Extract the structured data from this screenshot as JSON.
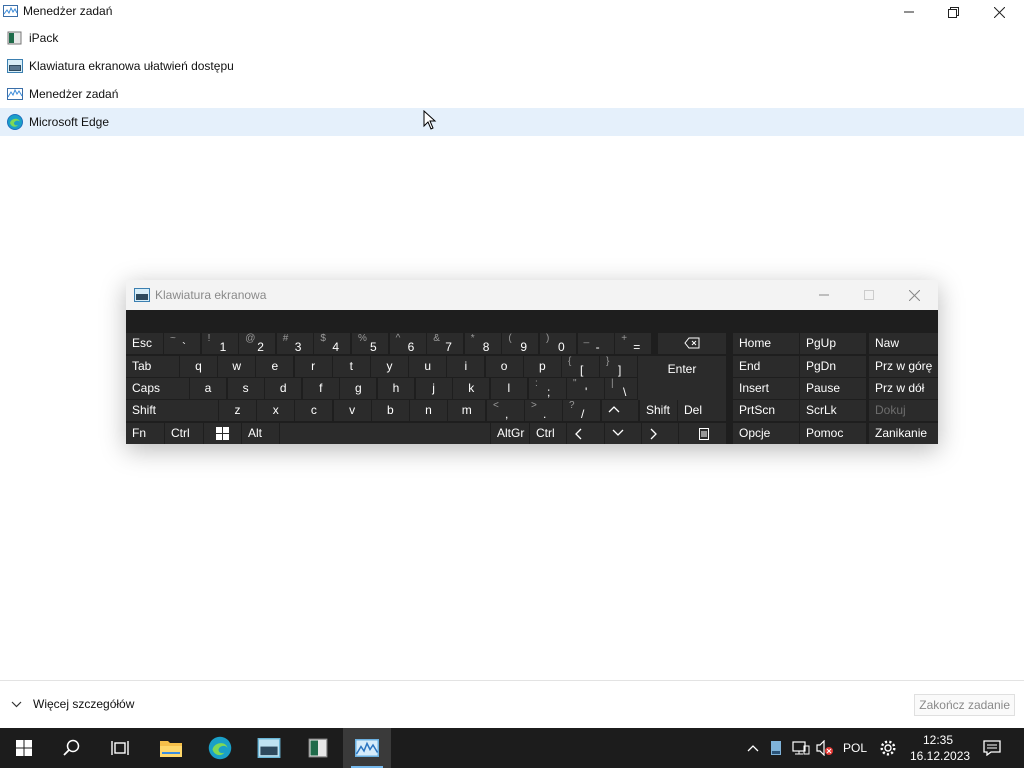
{
  "window": {
    "title": "Menedżer zadań"
  },
  "processes": [
    {
      "label": "iPack",
      "icon": "ipack-icon",
      "selected": false
    },
    {
      "label": "Klawiatura ekranowa ułatwień dostępu",
      "icon": "on-screen-keyboard-icon",
      "selected": false
    },
    {
      "label": "Menedżer zadań",
      "icon": "task-manager-icon",
      "selected": false
    },
    {
      "label": "Microsoft Edge",
      "icon": "edge-icon",
      "selected": true
    }
  ],
  "footer": {
    "more_details": "Więcej szczegółów",
    "end_task": "Zakończ zadanie"
  },
  "osk": {
    "title": "Klawiatura ekranowa",
    "keys": {
      "esc": "Esc",
      "tab": "Tab",
      "caps": "Caps",
      "shift": "Shift",
      "fn": "Fn",
      "ctrl": "Ctrl",
      "alt": "Alt",
      "enter": "Enter",
      "shift_r": "Shift",
      "del": "Del",
      "altgr": "AltGr",
      "ctrl_r": "Ctrl",
      "home": "Home",
      "pgup": "PgUp",
      "naw": "Naw",
      "end": "End",
      "pgdn": "PgDn",
      "prz_gore": "Prz w górę",
      "insert": "Insert",
      "pause": "Pause",
      "prz_dol": "Prz w dół",
      "prtscn": "PrtScn",
      "scrlk": "ScrLk",
      "dokuj": "Dokuj",
      "opcje": "Opcje",
      "pomoc": "Pomoc",
      "zanikanie": "Zanikanie",
      "row1": [
        {
          "sub": "~",
          "main": "`"
        },
        {
          "sub": "!",
          "main": "1"
        },
        {
          "sub": "@",
          "main": "2"
        },
        {
          "sub": "#",
          "main": "3"
        },
        {
          "sub": "$",
          "main": "4"
        },
        {
          "sub": "%",
          "main": "5"
        },
        {
          "sub": "^",
          "main": "6"
        },
        {
          "sub": "&",
          "main": "7"
        },
        {
          "sub": "*",
          "main": "8"
        },
        {
          "sub": "(",
          "main": "9"
        },
        {
          "sub": ")",
          "main": "0"
        },
        {
          "sub": "_",
          "main": "-"
        },
        {
          "sub": "+",
          "main": "="
        }
      ],
      "row2": [
        "q",
        "w",
        "e",
        "r",
        "t",
        "y",
        "u",
        "i",
        "o",
        "p"
      ],
      "row2_dual": [
        {
          "sub": "{",
          "main": "["
        },
        {
          "sub": "}",
          "main": "]"
        }
      ],
      "row3": [
        "a",
        "s",
        "d",
        "f",
        "g",
        "h",
        "j",
        "k",
        "l"
      ],
      "row3_dual": [
        {
          "sub": ":",
          "main": ";"
        },
        {
          "sub": "\"",
          "main": "'"
        },
        {
          "sub": "|",
          "main": "\\"
        }
      ],
      "row4": [
        "z",
        "x",
        "c",
        "v",
        "b",
        "n",
        "m"
      ],
      "row4_dual": [
        {
          "sub": "<",
          "main": ","
        },
        {
          "sub": ">",
          "main": "."
        },
        {
          "sub": "?",
          "main": "/"
        }
      ]
    }
  },
  "taskbar": {
    "language": "POL",
    "time": "12:35",
    "date": "16.12.2023"
  },
  "colors": {
    "selection": "#e5f0fb",
    "taskbar": "#1c1c1c",
    "keyboard": "#2b2b2b",
    "accent": "#76b9ed"
  }
}
